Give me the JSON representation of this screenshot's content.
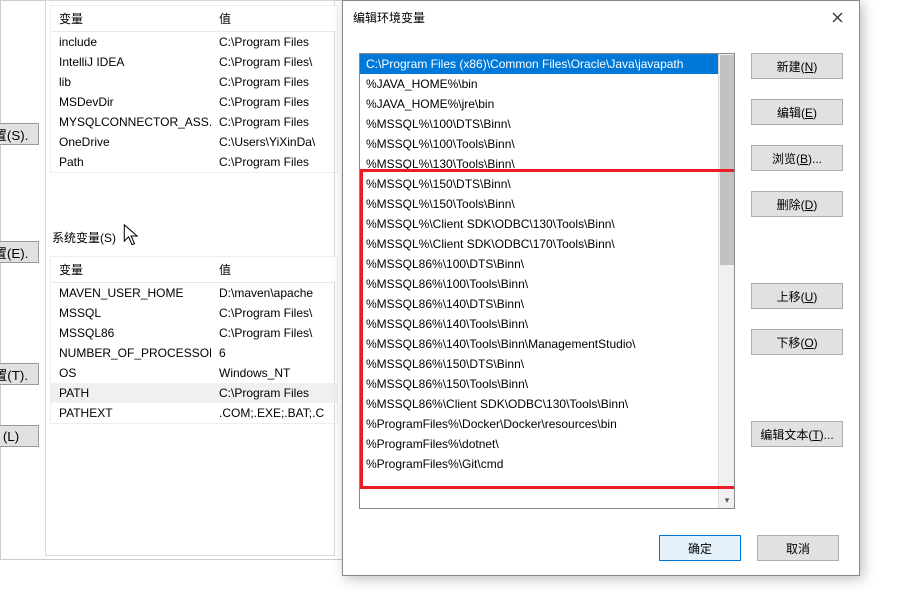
{
  "bg": {
    "side_btn_1": "置(S).",
    "side_btn_2": "置(E).",
    "side_btn_3": "置(T).",
    "side_btn_4": "(L)",
    "user_vars": {
      "header_var": "变量",
      "header_val": "值",
      "rows": [
        {
          "var": "include",
          "val": "C:\\Program Files"
        },
        {
          "var": "IntelliJ IDEA",
          "val": "C:\\Program Files\\"
        },
        {
          "var": "lib",
          "val": "C:\\Program Files"
        },
        {
          "var": "MSDevDir",
          "val": "C:\\Program Files"
        },
        {
          "var": "MYSQLCONNECTOR_ASS...",
          "val": "C:\\Program Files"
        },
        {
          "var": "OneDrive",
          "val": "C:\\Users\\YiXinDa\\"
        },
        {
          "var": "Path",
          "val": "C:\\Program Files"
        }
      ]
    },
    "sys_label": "系统变量(S)",
    "sys_vars": {
      "header_var": "变量",
      "header_val": "值",
      "rows": [
        {
          "var": "MAVEN_USER_HOME",
          "val": "D:\\maven\\apache"
        },
        {
          "var": "MSSQL",
          "val": "C:\\Program Files\\"
        },
        {
          "var": "MSSQL86",
          "val": "C:\\Program Files\\"
        },
        {
          "var": "NUMBER_OF_PROCESSORS",
          "val": "6"
        },
        {
          "var": "OS",
          "val": "Windows_NT"
        },
        {
          "var": "PATH",
          "val": "C:\\Program Files",
          "sel": true
        },
        {
          "var": "PATHEXT",
          "val": ".COM;.EXE;.BAT;.C"
        }
      ]
    }
  },
  "dialog": {
    "title": "编辑环境变量",
    "items": [
      {
        "t": "C:\\Program Files (x86)\\Common Files\\Oracle\\Java\\javapath",
        "sel": true
      },
      {
        "t": "%JAVA_HOME%\\bin"
      },
      {
        "t": "%JAVA_HOME%\\jre\\bin"
      },
      {
        "t": "%MSSQL%\\100\\DTS\\Binn\\"
      },
      {
        "t": "%MSSQL%\\100\\Tools\\Binn\\"
      },
      {
        "t": "%MSSQL%\\130\\Tools\\Binn\\"
      },
      {
        "t": "%MSSQL%\\150\\DTS\\Binn\\"
      },
      {
        "t": "%MSSQL%\\150\\Tools\\Binn\\"
      },
      {
        "t": "%MSSQL%\\Client SDK\\ODBC\\130\\Tools\\Binn\\"
      },
      {
        "t": "%MSSQL%\\Client SDK\\ODBC\\170\\Tools\\Binn\\"
      },
      {
        "t": "%MSSQL86%\\100\\DTS\\Binn\\"
      },
      {
        "t": "%MSSQL86%\\100\\Tools\\Binn\\"
      },
      {
        "t": "%MSSQL86%\\140\\DTS\\Binn\\"
      },
      {
        "t": "%MSSQL86%\\140\\Tools\\Binn\\"
      },
      {
        "t": "%MSSQL86%\\140\\Tools\\Binn\\ManagementStudio\\"
      },
      {
        "t": "%MSSQL86%\\150\\DTS\\Binn\\"
      },
      {
        "t": "%MSSQL86%\\150\\Tools\\Binn\\"
      },
      {
        "t": "%MSSQL86%\\Client SDK\\ODBC\\130\\Tools\\Binn\\"
      },
      {
        "t": "%ProgramFiles%\\Docker\\Docker\\resources\\bin"
      },
      {
        "t": "%ProgramFiles%\\dotnet\\"
      },
      {
        "t": "%ProgramFiles%\\Git\\cmd"
      }
    ],
    "btn_new": "新建(N)",
    "btn_edit": "编辑(E)",
    "btn_browse": "浏览(B)...",
    "btn_delete": "删除(D)",
    "btn_up": "上移(U)",
    "btn_down": "下移(O)",
    "btn_edit_text": "编辑文本(T)...",
    "btn_ok": "确定",
    "btn_cancel": "取消"
  }
}
